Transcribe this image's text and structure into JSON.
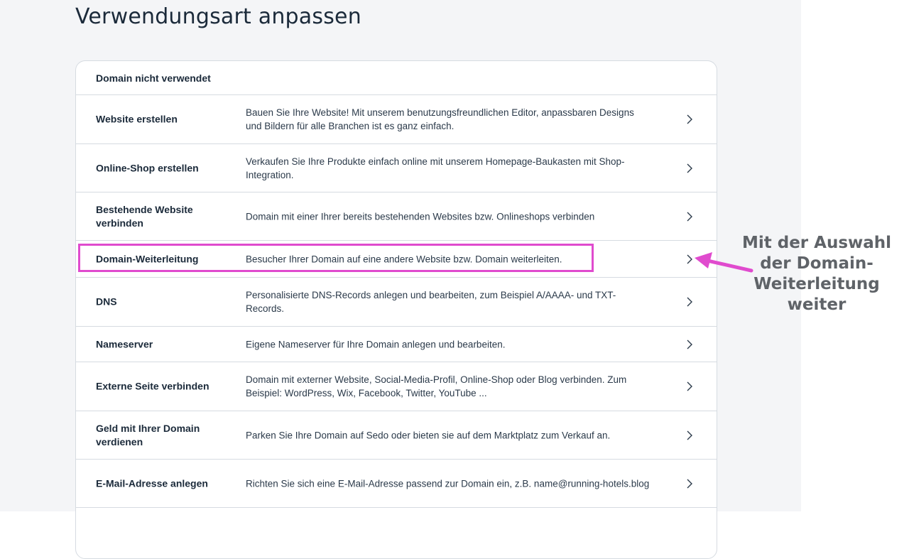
{
  "page": {
    "title": "Verwendungsart anpassen"
  },
  "panel": {
    "header": "Domain nicht verwendet",
    "rows": [
      {
        "title": "Website erstellen",
        "description": "Bauen Sie Ihre Website! Mit unserem benutzungsfreundlichen Editor, anpassbaren Designs und Bildern für alle Branchen ist es ganz einfach."
      },
      {
        "title": "Online-Shop erstellen",
        "description": "Verkaufen Sie Ihre Produkte einfach online mit unserem Homepage-Baukasten mit Shop-Integration."
      },
      {
        "title": "Bestehende Website verbinden",
        "description": "Domain mit einer Ihrer bereits bestehenden Websites bzw. Onlineshops verbinden"
      },
      {
        "title": "Domain-Weiterleitung",
        "description": "Besucher Ihrer Domain auf eine andere Website bzw. Domain weiterleiten."
      },
      {
        "title": "DNS",
        "description": "Personalisierte DNS-Records anlegen und bearbeiten, zum Beispiel A/AAAA- und TXT-Records."
      },
      {
        "title": "Nameserver",
        "description": "Eigene Nameserver für Ihre Domain anlegen und bearbeiten."
      },
      {
        "title": "Externe Seite verbinden",
        "description": "Domain mit externer Website, Social-Media-Profil, Online-Shop oder Blog verbinden. Zum Beispiel: WordPress, Wix, Facebook, Twitter, YouTube ..."
      },
      {
        "title": "Geld mit Ihrer Domain verdienen",
        "description": "Parken Sie Ihre Domain auf Sedo oder bieten sie auf dem Marktplatz zum Verkauf an."
      },
      {
        "title": "E-Mail-Adresse anlegen",
        "description": "Richten Sie sich eine E-Mail-Adresse passend zur Domain ein, z.B. name@running-hotels.blog"
      }
    ],
    "row_icon": "chevron-right-icon"
  },
  "annotation": {
    "text": "Mit der Auswahl der Domain-Weiterleitung weiter",
    "highlighted_option": "Domain-Weiterleitung",
    "color": "#e04bce"
  },
  "colors": {
    "page_background": "#f4f5f7",
    "panel_background": "#ffffff",
    "divider": "#d6dbe1",
    "text": "#1b2a3a",
    "annotation_text": "#5f6368"
  }
}
